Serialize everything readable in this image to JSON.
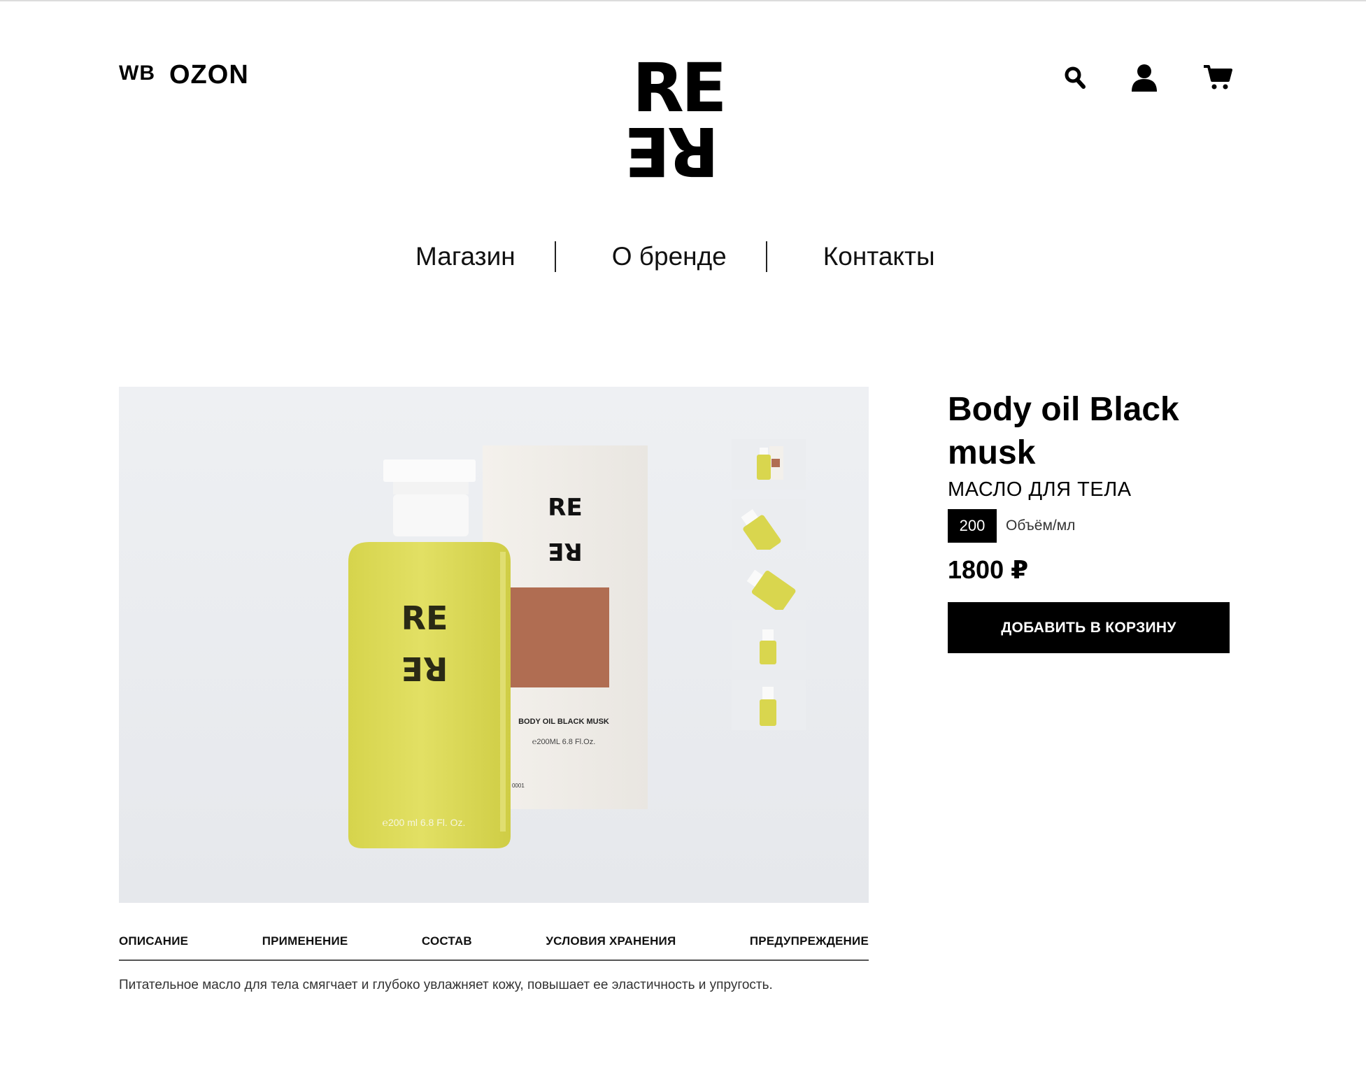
{
  "header": {
    "wb_label": "WB",
    "ozon_label": "OZON",
    "logo_top": "RE",
    "logo_bottom": "RE",
    "icons": [
      "search-icon",
      "user-icon",
      "cart-icon"
    ]
  },
  "nav": {
    "items": [
      {
        "label": "Магазин"
      },
      {
        "label": "О бренде"
      },
      {
        "label": "Контакты"
      }
    ]
  },
  "product": {
    "title": "Body oil Black musk",
    "subtitle": "МАСЛО ДЛЯ ТЕЛА",
    "volume_value": "200",
    "volume_label": "Объём/мл",
    "price": "1800 ₽",
    "add_to_cart": "ДОБАВИТЬ В КОРЗИНУ",
    "photo": {
      "bottle_logo_top": "RE",
      "bottle_logo_bottom": "RE",
      "bottle_volume": "℮200 ml  6.8 Fl. Oz.",
      "box_logo_top": "RE",
      "box_logo_bottom": "RE",
      "box_name": "BODY OIL BLACK MUSK",
      "box_volume": "℮200ML 6.8 Fl.Oz.",
      "box_code": "T 0001"
    },
    "thumbnails_count": 5
  },
  "tabs": {
    "items": [
      {
        "label": "ОПИСАНИЕ"
      },
      {
        "label": "ПРИМЕНЕНИЕ"
      },
      {
        "label": "СОСТАВ"
      },
      {
        "label": "УСЛОВИЯ ХРАНЕНИЯ"
      },
      {
        "label": "ПРЕДУПРЕЖДЕНИЕ"
      }
    ],
    "active": "ОПИСАНИЕ"
  },
  "description": "Питательное масло для тела смягчает и глубоко увлажняет кожу, повышает ее эластичность и упругость.",
  "colors": {
    "accent": "#000000",
    "oil": "#d9d64e",
    "background_photo": "#eceef1"
  }
}
